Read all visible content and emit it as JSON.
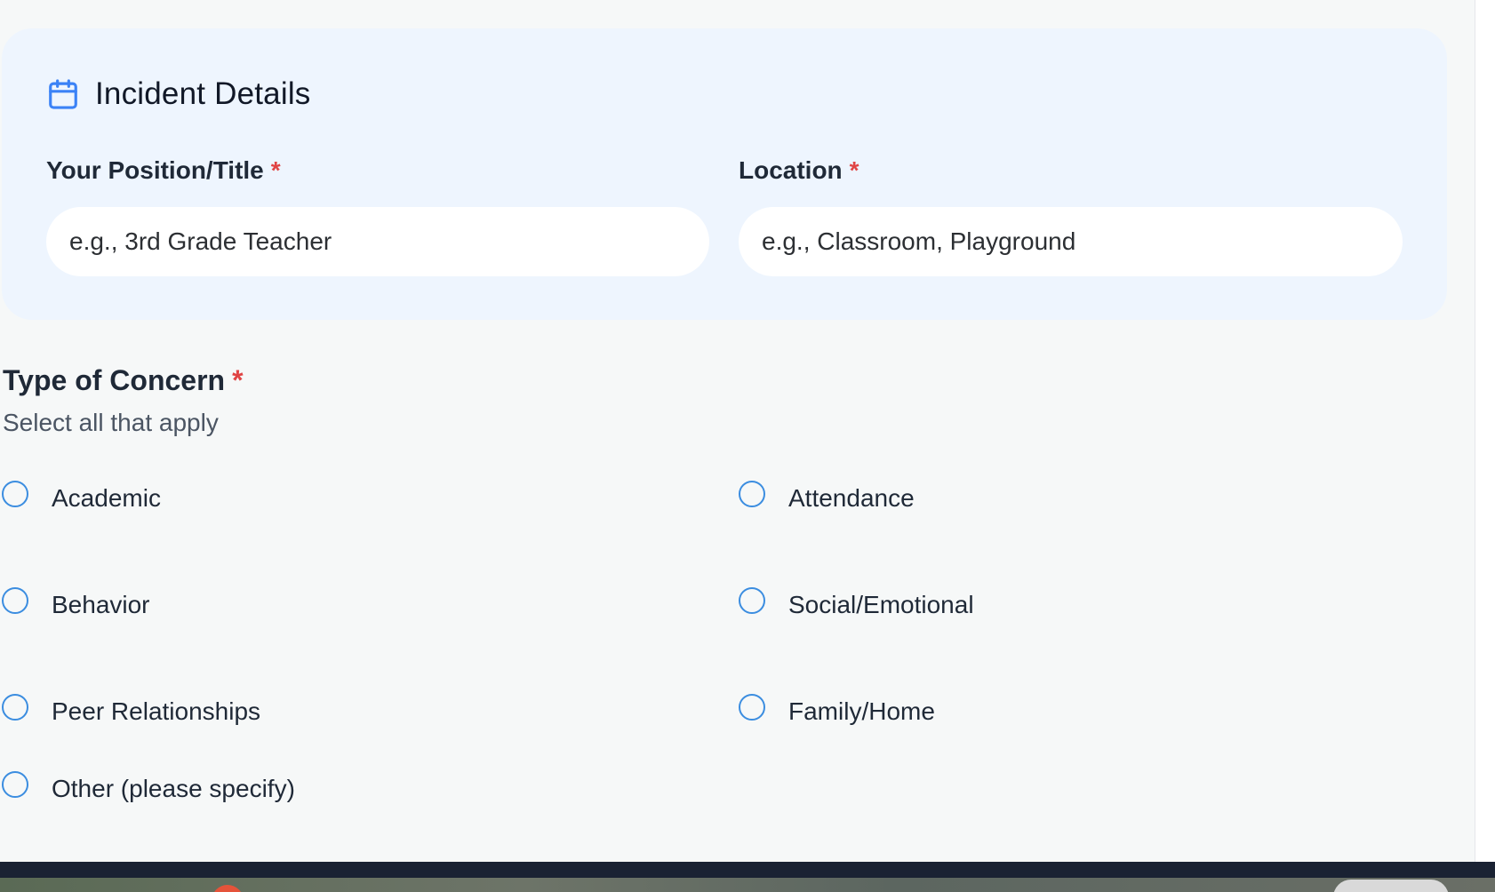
{
  "card": {
    "title": "Incident Details",
    "title_icon": "calendar-icon",
    "accent_color": "#3b82f6",
    "required_marker": "*",
    "position_field": {
      "label": "Your Position/Title",
      "placeholder": "e.g., 3rd Grade Teacher",
      "value": ""
    },
    "location_field": {
      "label": "Location",
      "placeholder": "e.g., Classroom, Playground",
      "value": ""
    }
  },
  "concern": {
    "title": "Type of Concern",
    "required_marker": "*",
    "subtitle": "Select all that apply",
    "options": [
      {
        "label": "Academic",
        "selected": false
      },
      {
        "label": "Attendance",
        "selected": false
      },
      {
        "label": "Behavior",
        "selected": false
      },
      {
        "label": "Social/Emotional",
        "selected": false
      },
      {
        "label": "Peer Relationships",
        "selected": false
      },
      {
        "label": "Family/Home",
        "selected": false
      },
      {
        "label": "Other (please specify)",
        "selected": false
      }
    ]
  },
  "colors": {
    "background": "#f6f8f8",
    "card_background": "#eef5fe",
    "required": "#e04444",
    "radio_border": "#3b8de0"
  }
}
